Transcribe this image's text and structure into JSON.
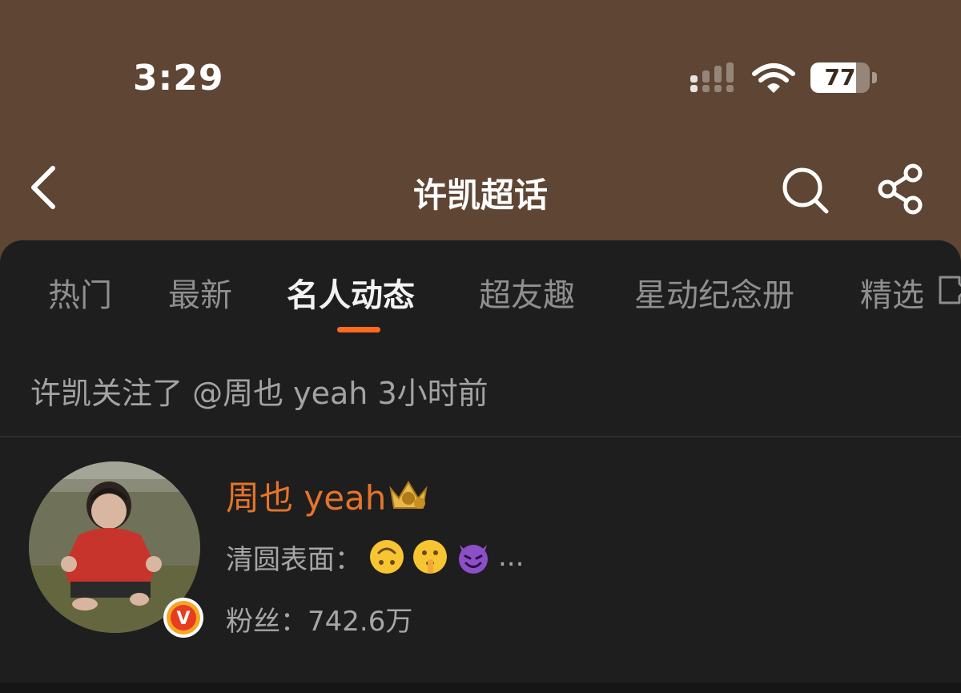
{
  "status_bar": {
    "time": "3:29",
    "battery_level": "77",
    "battery_fraction": 0.77,
    "icons": [
      "cellular-signal-icon",
      "wifi-icon",
      "battery-icon"
    ]
  },
  "nav": {
    "title": "许凯超话",
    "icons": [
      "back-chevron-icon",
      "search-icon",
      "share-icon"
    ]
  },
  "tabs": [
    {
      "label": "热门",
      "active": false
    },
    {
      "label": "最新",
      "active": false
    },
    {
      "label": "名人动态",
      "active": true
    },
    {
      "label": "超友趣",
      "active": false
    },
    {
      "label": "星动纪念册",
      "active": false
    },
    {
      "label": "精选",
      "active": false
    }
  ],
  "activity": {
    "text": "许凯关注了 @周也 yeah 3小时前"
  },
  "user_card": {
    "name": "周也 yeah",
    "bio_label": "清圆表面：",
    "bio_emojis": [
      "upside-down-face-emoji",
      "shushing-face-emoji",
      "smiling-imp-emoji"
    ],
    "bio_ellipsis": "...",
    "fans": "粉丝：742.6万",
    "badge_letter": "V"
  },
  "colors": {
    "header_bg": "#5f4533",
    "panel_bg": "#1e1e1e",
    "accent": "#ff6a1f",
    "username": "#e5742a",
    "verify_badge": "#f5a623"
  }
}
